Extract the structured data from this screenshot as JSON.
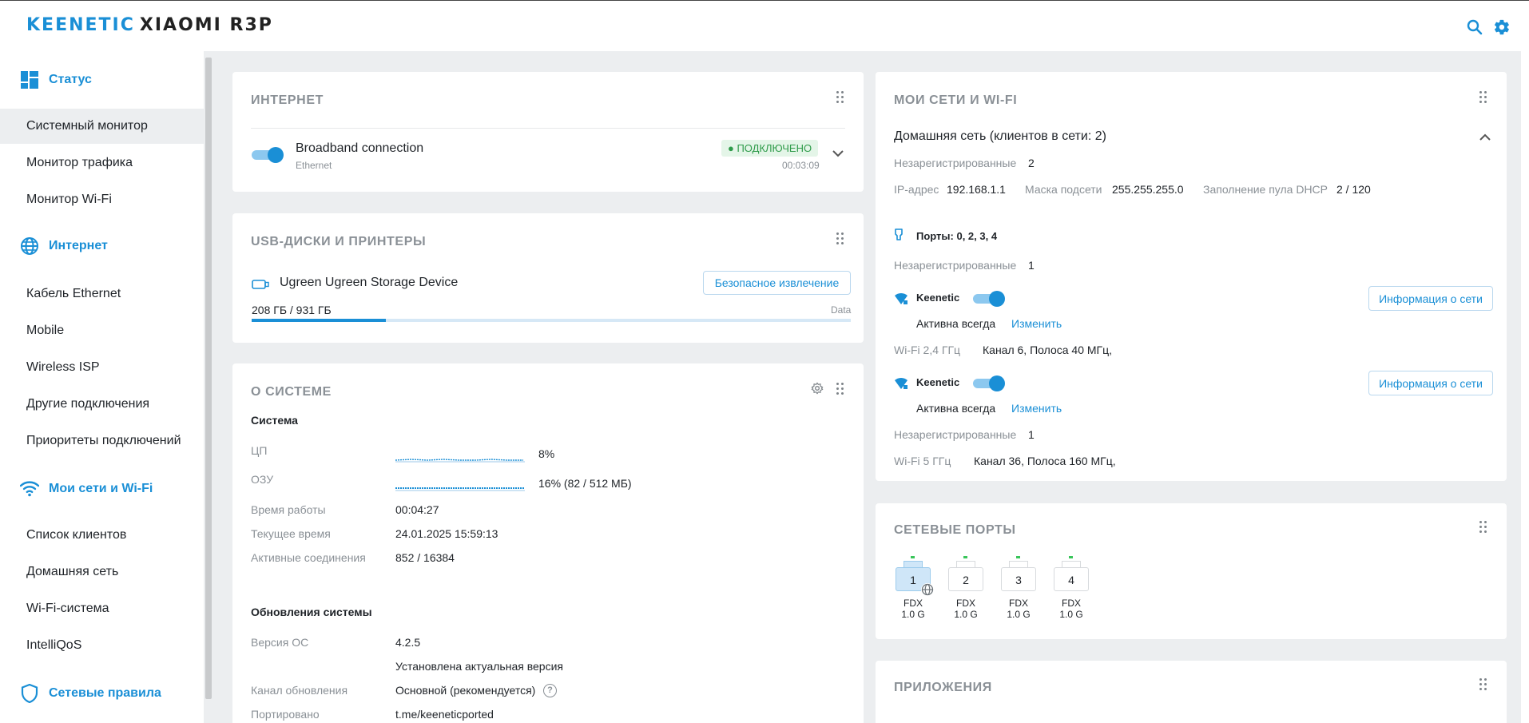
{
  "header": {
    "brand": "KEENETIC",
    "model": "XIAOMI R3P",
    "search_icon": "search-icon",
    "settings_icon": "gear-icon",
    "accent": "#1a8fd6"
  },
  "sidebar": {
    "sections": {
      "status": "Статус",
      "internet": "Интернет",
      "wifi": "Мои сети и Wi-Fi",
      "rules": "Сетевые правила"
    },
    "items": {
      "system_monitor": "Системный монитор",
      "traffic_monitor": "Монитор трафика",
      "wifi_monitor": "Монитор Wi-Fi",
      "ethernet_cable": "Кабель Ethernet",
      "mobile": "Mobile",
      "wireless_isp": "Wireless ISP",
      "other_connections": "Другие подключения",
      "connection_priorities": "Приоритеты подключений",
      "client_list": "Список клиентов",
      "home_network": "Домашняя сеть",
      "wifi_system": "Wi-Fi-система",
      "intelliqos": "IntelliQoS"
    }
  },
  "internet_card": {
    "title": "ИНТЕРНЕТ",
    "connection_name": "Broadband connection",
    "connection_type": "Ethernet",
    "status": "● ПОДКЛЮЧЕНО",
    "uptime": "00:03:09",
    "enabled": true
  },
  "usb_card": {
    "title": "USB-ДИСКИ И ПРИНТЕРЫ",
    "device_name": "Ugreen Ugreen Storage Device",
    "eject_label": "Безопасное извлечение",
    "usage": "208 ГБ / 931 ГБ",
    "volume_label": "Data",
    "usage_fraction": 0.2234
  },
  "system_card": {
    "title": "О СИСТЕМЕ",
    "system_heading": "Система",
    "cpu_label": "ЦП",
    "cpu_value": "8%",
    "ram_label": "ОЗУ",
    "ram_value": "16% (82 / 512 МБ)",
    "uptime_label": "Время работы",
    "uptime_value": "00:04:27",
    "time_label": "Текущее время",
    "time_value": "24.01.2025 15:59:13",
    "sessions_label": "Активные соединения",
    "sessions_value": "852 / 16384",
    "updates_heading": "Обновления системы",
    "os_label": "Версия ОС",
    "os_value": "4.2.5",
    "os_status": "Установлена актуальная версия",
    "channel_label": "Канал обновления",
    "channel_value": "Основной (рекомендуется)",
    "ported_label": "Портировано",
    "ported_value": "t.me/keeneticported"
  },
  "networks_card": {
    "title": "МОИ СЕТИ И WI-FI",
    "home_title": "Домашняя сеть (клиентов в сети: 2)",
    "unregistered_label": "Незарегистрированные",
    "unregistered_value": "2",
    "ip_label": "IP-адрес",
    "ip_value": "192.168.1.1",
    "mask_label": "Маска подсети",
    "mask_value": "255.255.255.0",
    "dhcp_label": "Заполнение пула DHCP",
    "dhcp_value": "2 / 120",
    "ports_label": "Порты: 0, 2, 3, 4",
    "ports_unregistered_label": "Незарегистрированные",
    "ports_unregistered_value": "1",
    "wifi_24": {
      "ssid": "Keenetic",
      "schedule": "Активна всегда",
      "change": "Изменить",
      "info_button": "Информация о сети",
      "band_label": "Wi-Fi 2,4 ГГц",
      "band_value": "Канал 6,  Полоса 40 МГц,"
    },
    "wifi_5": {
      "ssid": "Keenetic",
      "schedule": "Активна всегда",
      "change": "Изменить",
      "info_button": "Информация о сети",
      "unregistered_label": "Незарегистрированные",
      "unregistered_value": "1",
      "band_label": "Wi-Fi 5 ГГц",
      "band_value": "Канал 36,  Полоса 160 МГц,"
    }
  },
  "ports_card": {
    "title": "СЕТЕВЫЕ ПОРТЫ",
    "ports": [
      {
        "number": "1",
        "mode": "FDX",
        "speed": "1.0 G"
      },
      {
        "number": "2",
        "mode": "FDX",
        "speed": "1.0 G"
      },
      {
        "number": "3",
        "mode": "FDX",
        "speed": "1.0 G"
      },
      {
        "number": "4",
        "mode": "FDX",
        "speed": "1.0 G"
      }
    ]
  },
  "apps_card": {
    "title": "ПРИЛОЖЕНИЯ"
  }
}
